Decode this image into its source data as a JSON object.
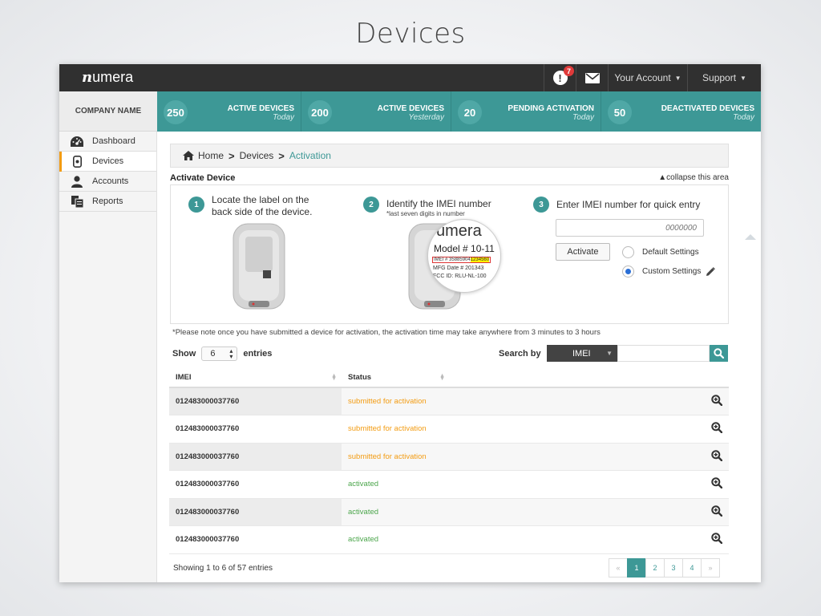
{
  "slide_title": "Devices",
  "brand": {
    "n": "n",
    "rest": "umera"
  },
  "topnav": {
    "alert_count": "7",
    "alert_glyph": "!",
    "account_label": "Your Account",
    "support_label": "Support"
  },
  "company_name": "COMPANY NAME",
  "stats": [
    {
      "value": "250",
      "label": "ACTIVE DEVICES",
      "sub": "Today"
    },
    {
      "value": "200",
      "label": "ACTIVE DEVICES",
      "sub": "Yesterday"
    },
    {
      "value": "20",
      "label": "PENDING ACTIVATION",
      "sub": "Today"
    },
    {
      "value": "50",
      "label": "DEACTIVATED DEVICES",
      "sub": "Today"
    }
  ],
  "sidebar": {
    "items": [
      {
        "label": "Dashboard",
        "icon": "dashboard-gauge-icon"
      },
      {
        "label": "Devices",
        "icon": "device-icon"
      },
      {
        "label": "Accounts",
        "icon": "user-icon"
      },
      {
        "label": "Reports",
        "icon": "reports-icon"
      }
    ]
  },
  "breadcrumb": {
    "home": "Home",
    "devices": "Devices",
    "current": "Activation"
  },
  "activate": {
    "title": "Activate Device",
    "collapse_label": "collapse this area",
    "steps": [
      {
        "num": "1",
        "line1": "Locate the label on the",
        "line2": "back side of the device."
      },
      {
        "num": "2",
        "line1": "Identify the IMEI number",
        "sub": "*last seven digits in number"
      },
      {
        "num": "3",
        "line1": "Enter IMEI number for quick entry"
      }
    ],
    "label_zoom": {
      "brand": "umera",
      "model": "Model # 10-11",
      "imei_prefix": "IMEI #",
      "imei_start": "35885904",
      "imei_highlight": "1234560",
      "mfg": "MFG Date # 201343",
      "fcc": "FCC ID: RLU-NL-100"
    },
    "imei_placeholder": "0000000",
    "button_label": "Activate",
    "option_default": "Default Settings",
    "option_custom": "Custom Settings"
  },
  "note": "*Please note once you have submitted a device for activation, the activation time may take anywhere from 3 minutes to 3 hours",
  "table_controls": {
    "show_label": "Show",
    "entries_value": "6",
    "entries_label": "entries",
    "search_by_label": "Search by",
    "search_field": "IMEI"
  },
  "table": {
    "headers": [
      "IMEI",
      "Status"
    ],
    "rows": [
      {
        "imei": "012483000037760",
        "status": "submitted for activation"
      },
      {
        "imei": "012483000037760",
        "status": "submitted for activation"
      },
      {
        "imei": "012483000037760",
        "status": "submitted for activation"
      },
      {
        "imei": "012483000037760",
        "status": "activated"
      },
      {
        "imei": "012483000037760",
        "status": "activated"
      },
      {
        "imei": "012483000037760",
        "status": "activated"
      }
    ]
  },
  "footer": {
    "info": "Showing 1 to 6 of 57 entries"
  },
  "pagination": {
    "prev": "«",
    "pages": [
      "1",
      "2",
      "3",
      "4"
    ],
    "next": "»"
  },
  "colors": {
    "accent": "#3d9896",
    "pending": "#f39c12",
    "activated": "#4ca64c",
    "nav": "#303030"
  }
}
